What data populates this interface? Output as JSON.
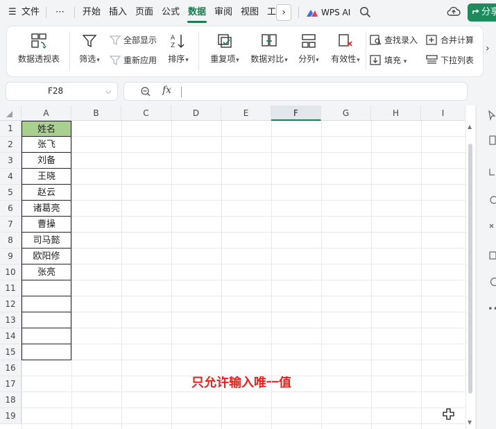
{
  "menu": {
    "hamburger": "☰",
    "file": "文件",
    "more": "⋯",
    "tabs": [
      "开始",
      "插入",
      "页面",
      "公式",
      "数据",
      "审阅",
      "视图",
      "工"
    ],
    "active_tab": "数据",
    "next_arrow": "›",
    "wps_ai": "WPS AI",
    "share": "分享"
  },
  "ribbon": {
    "pivot": "数据透视表",
    "filter": "筛选",
    "show_all": "全部显示",
    "reapply": "重新应用",
    "sort": "排序",
    "duplicates": "重复项",
    "compare": "数据对比",
    "split": "分列",
    "validation": "有效性",
    "lookup_entry": "查找录入",
    "fill": "填充",
    "consolidate": "合并计算",
    "dropdown_list": "下拉列表",
    "more_arrow": "›"
  },
  "formula_bar": {
    "cell_ref": "F28",
    "fx": "fx",
    "formula": ""
  },
  "sheet": {
    "columns": [
      "A",
      "B",
      "C",
      "D",
      "E",
      "F",
      "G",
      "H",
      "I"
    ],
    "selected_column": "F",
    "rows": [
      "1",
      "2",
      "3",
      "4",
      "5",
      "6",
      "7",
      "8",
      "9",
      "10",
      "11",
      "12",
      "13",
      "14",
      "15",
      "16",
      "17",
      "18",
      "19"
    ],
    "column_a": [
      "姓名",
      "张飞",
      "刘备",
      "王晓",
      "赵云",
      "诸葛亮",
      "曹操",
      "司马懿",
      "欧阳修",
      "张亮",
      "",
      "",
      "",
      "",
      ""
    ],
    "header_fill": "#a9d08e",
    "annotation": "只允许输入唯一值",
    "annotation_color": "#e8201c"
  },
  "colors": {
    "accent": "#1a7a50",
    "share_bg": "#1f8a5b"
  },
  "icons": [
    "menu-icon",
    "more-icon",
    "chevron-right-icon",
    "wps-ai-logo-icon",
    "search-icon",
    "cloud-upload-icon",
    "pivot-table-icon",
    "filter-icon",
    "sort-icon",
    "duplicates-icon",
    "compare-icon",
    "split-column-icon",
    "validation-icon",
    "lookup-icon",
    "fill-icon",
    "consolidate-icon",
    "dropdown-list-icon",
    "zoom-icon",
    "crosshair-cursor-icon"
  ]
}
